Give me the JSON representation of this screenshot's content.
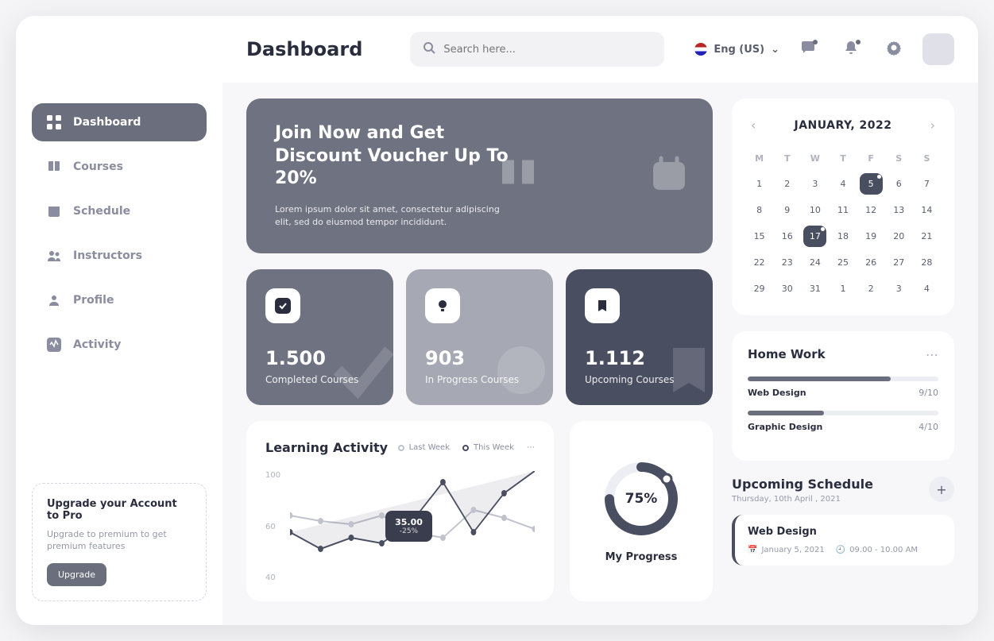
{
  "header": {
    "title": "Dashboard",
    "search_placeholder": "Search here...",
    "language": "Eng (US)"
  },
  "sidebar": {
    "items": [
      {
        "label": "Dashboard"
      },
      {
        "label": "Courses"
      },
      {
        "label": "Schedule"
      },
      {
        "label": "Instructors"
      },
      {
        "label": "Profile"
      },
      {
        "label": "Activity"
      }
    ],
    "upgrade": {
      "title": "Upgrade your Account to Pro",
      "desc": "Upgrade to premium to get premium features",
      "button": "Upgrade"
    }
  },
  "banner": {
    "title": "Join Now and Get Discount Voucher Up To 20%",
    "desc": "Lorem ipsum dolor sit amet, consectetur adipiscing elit, sed do eiusmod tempor incididunt."
  },
  "stats": [
    {
      "value": "1.500",
      "label": "Completed Courses"
    },
    {
      "value": "903",
      "label": "In Progress Courses"
    },
    {
      "value": "1.112",
      "label": "Upcoming Courses"
    }
  ],
  "chart": {
    "title": "Learning Activity",
    "legend": {
      "last": "Last Week",
      "this": "This Week"
    },
    "tooltip": {
      "value": "35.00",
      "pct": "-25%"
    }
  },
  "chart_data": {
    "type": "line",
    "y_ticks": [
      100,
      60,
      40
    ],
    "ylim": [
      0,
      100
    ],
    "series": [
      {
        "name": "Last Week",
        "values": [
          60,
          55,
          52,
          60,
          45,
          40,
          65,
          58,
          48
        ]
      },
      {
        "name": "This Week",
        "values": [
          45,
          30,
          40,
          35,
          55,
          90,
          45,
          80,
          100
        ]
      }
    ]
  },
  "progress": {
    "percent": "75%",
    "label": "My Progress"
  },
  "calendar": {
    "month": "JANUARY, 2022",
    "dow": [
      "M",
      "T",
      "W",
      "T",
      "F",
      "S",
      "S"
    ],
    "days": [
      1,
      2,
      3,
      4,
      5,
      6,
      7,
      8,
      9,
      10,
      11,
      12,
      13,
      14,
      15,
      16,
      17,
      18,
      19,
      20,
      21,
      22,
      23,
      24,
      25,
      26,
      27,
      28,
      29,
      30,
      31,
      1,
      2,
      3,
      4
    ],
    "marked": [
      5,
      17
    ]
  },
  "homework": {
    "title": "Home Work",
    "items": [
      {
        "name": "Web Design",
        "score": "9/10",
        "pct": 75
      },
      {
        "name": "Graphic Design",
        "score": "4/10",
        "pct": 40
      }
    ]
  },
  "schedule": {
    "title": "Upcoming Schedule",
    "date": "Thursday, 10th April , 2021",
    "item": {
      "title": "Web Design",
      "date": "January 5, 2021",
      "time": "09.00 - 10.00 AM"
    }
  }
}
